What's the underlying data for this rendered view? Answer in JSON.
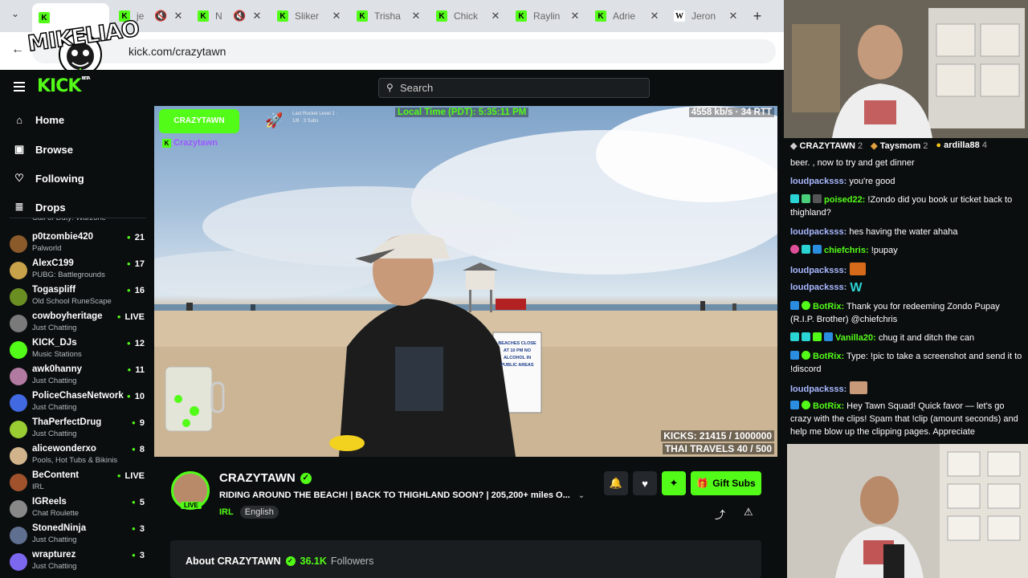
{
  "browser": {
    "tabs": [
      {
        "title": "",
        "icon": "kick"
      },
      {
        "title": "je",
        "icon": "kick",
        "muted": true
      },
      {
        "title": "N",
        "icon": "kick",
        "muted": true
      },
      {
        "title": "Sliker",
        "icon": "kick"
      },
      {
        "title": "Trisha",
        "icon": "kick"
      },
      {
        "title": "Chick",
        "icon": "kick"
      },
      {
        "title": "Raylin",
        "icon": "kick"
      },
      {
        "title": "Adrie",
        "icon": "kick"
      },
      {
        "title": "Jeron",
        "icon": "wikipedia"
      }
    ],
    "url": "kick.com/crazytawn"
  },
  "overlay_logo": "MIKELIAO",
  "header": {
    "logo": "KICK",
    "logo_badge": "BETA",
    "search_placeholder": "Search"
  },
  "nav": {
    "home": "Home",
    "browse": "Browse",
    "following": "Following",
    "drops": "Drops"
  },
  "sidebar_partial_category": "Call of Duty: Warzone",
  "following": [
    {
      "name": "p0tzombie420",
      "category": "Palworld",
      "viewers": "21",
      "color": "#8b5a2b"
    },
    {
      "name": "AlexC199",
      "category": "PUBG: Battlegrounds",
      "viewers": "17",
      "color": "#c8a24a"
    },
    {
      "name": "Togaspliff",
      "category": "Old School RuneScape",
      "viewers": "16",
      "color": "#6b8e23"
    },
    {
      "name": "cowboyheritage",
      "category": "Just Chatting",
      "viewers": "LIVE",
      "color": "#7a7a7a"
    },
    {
      "name": "KICK_DJs",
      "category": "Music Stations",
      "viewers": "12",
      "color": "#53fc18"
    },
    {
      "name": "awk0hanny",
      "category": "Just Chatting",
      "viewers": "11",
      "color": "#b07aa1"
    },
    {
      "name": "PoliceChaseNetwork",
      "category": "Just Chatting",
      "viewers": "10",
      "color": "#4169e1"
    },
    {
      "name": "ThaPerfectDrug",
      "category": "Just Chatting",
      "viewers": "9",
      "color": "#9acd32"
    },
    {
      "name": "alicewonderxo",
      "category": "Pools, Hot Tubs & Bikinis",
      "viewers": "8",
      "color": "#d2b48c"
    },
    {
      "name": "BeContent",
      "category": "IRL",
      "viewers": "LIVE",
      "color": "#a0522d"
    },
    {
      "name": "IGReels",
      "category": "Chat Roulette",
      "viewers": "5",
      "color": "#888888"
    },
    {
      "name": "StonedNinja",
      "category": "Just Chatting",
      "viewers": "3",
      "color": "#5f6f8f"
    },
    {
      "name": "wrapturez",
      "category": "Just Chatting",
      "viewers": "3",
      "color": "#7b68ee"
    }
  ],
  "video": {
    "overlay_brand": "CRAZYTAWN",
    "overlay_tag": "Crazytawn",
    "local_time": "Local Time (PDT): 5:35:11 PM",
    "bitrate": "4558 kb/s · 34 RTT",
    "kicks": "KICKS: 21415 / 1000000",
    "travels": "THAI TRAVELS 40 / 500",
    "sign_text": "BEACHES CLOSE AT 10 PM NO ALCOHOL IN PUBLIC AREAS",
    "rocket_text": "Last Rocket Level 1 · 1/8 · 3 Subs"
  },
  "channel": {
    "name": "CRAZYTAWN",
    "title": "RIDING AROUND THE BEACH! | BACK TO THIGHLAND SOON? | 205,200+ miles O...",
    "category": "IRL",
    "language": "English",
    "live_label": "LIVE",
    "gift_subs": "Gift Subs",
    "about": "About CRAZYTAWN",
    "followers_count": "36.1K",
    "followers_label": "Followers"
  },
  "chat": {
    "top_gifters": [
      {
        "name": "CRAZYTAWN",
        "count": "2"
      },
      {
        "name": "Taysmom",
        "count": "2"
      },
      {
        "name": "ardilla88",
        "count": "4"
      }
    ],
    "messages": [
      {
        "user": "",
        "text": "beer. , now to try and get dinner",
        "color": "#ffffff"
      },
      {
        "user": "loudpacksss:",
        "text": " you're good",
        "color": "#a8b8ff"
      },
      {
        "user": "poised22:",
        "text": " !Zondo did you book ur ticket back to thighland?",
        "color": "#53fc18"
      },
      {
        "user": "loudpacksss:",
        "text": " hes having the water ahaha",
        "color": "#a8b8ff"
      },
      {
        "user": "chiefchris:",
        "text": " !pupay",
        "color": "#53fc18"
      },
      {
        "user": "loudpacksss:",
        "text": "",
        "color": "#a8b8ff"
      },
      {
        "user": "loudpacksss:",
        "text": "",
        "color": "#a8b8ff"
      },
      {
        "user": "BotRix:",
        "text": " Thank you for redeeming Zondo Pupay (R.I.P. Brother) @chiefchris",
        "color": "#53fc18"
      },
      {
        "user": "Vanilla20:",
        "text": " chug it and ditch the can",
        "color": "#53fc18"
      },
      {
        "user": "BotRix:",
        "text": " Type: !pic to take a screenshot and send it to !discord",
        "color": "#53fc18"
      },
      {
        "user": "loudpacksss:",
        "text": "",
        "color": "#a8b8ff"
      },
      {
        "user": "BotRix:",
        "text": " Hey Tawn Squad! Quick favor — let's go crazy with the clips! Spam that !clip (amount seconds) and help me blow up the clipping pages. Appreciate",
        "color": "#53fc18"
      }
    ]
  },
  "colors": {
    "accent": "#53fc18",
    "bg": "#0b0e0f"
  }
}
